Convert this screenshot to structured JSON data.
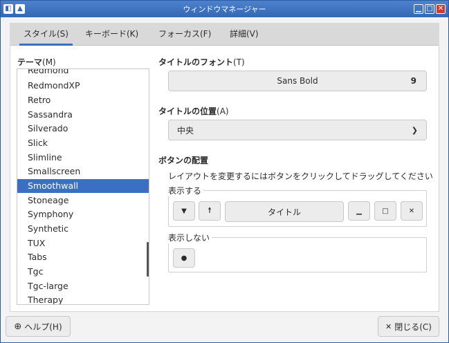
{
  "window": {
    "title": "ウィンドウマネージャー"
  },
  "tabs": [
    {
      "label": "スタイル(S)",
      "active": true
    },
    {
      "label": "キーボード(K)",
      "active": false
    },
    {
      "label": "フォーカス(F)",
      "active": false
    },
    {
      "label": "詳細(V)",
      "active": false
    }
  ],
  "theme": {
    "label": "テーマ",
    "mnemonic": "(M)",
    "items": [
      "Redmond",
      "RedmondXP",
      "Retro",
      "Sassandra",
      "Silverado",
      "Slick",
      "Slimline",
      "Smallscreen",
      "Smoothwall",
      "Stoneage",
      "Symphony",
      "Synthetic",
      "TUX",
      "Tabs",
      "Tgc",
      "Tgc-large",
      "Therapy"
    ],
    "selected": "Smoothwall"
  },
  "title_font": {
    "label": "タイトルのフォント",
    "mnemonic": "(T)",
    "font_name": "Sans Bold",
    "font_size": "9"
  },
  "title_position": {
    "label": "タイトルの位置",
    "mnemonic": "(A)",
    "value": "中央"
  },
  "button_layout": {
    "label": "ボタンの配置",
    "hint": "レイアウトを変更するにはボタンをクリックしてドラッグしてください",
    "shown_label": "表示する",
    "hidden_label": "表示しない",
    "title_button": "タイトル"
  },
  "footer": {
    "help": "ヘルプ(H)",
    "close": "閉じる(C)"
  },
  "colors": {
    "accent": "#3b6fc1",
    "titlebar": "#3467b4"
  }
}
